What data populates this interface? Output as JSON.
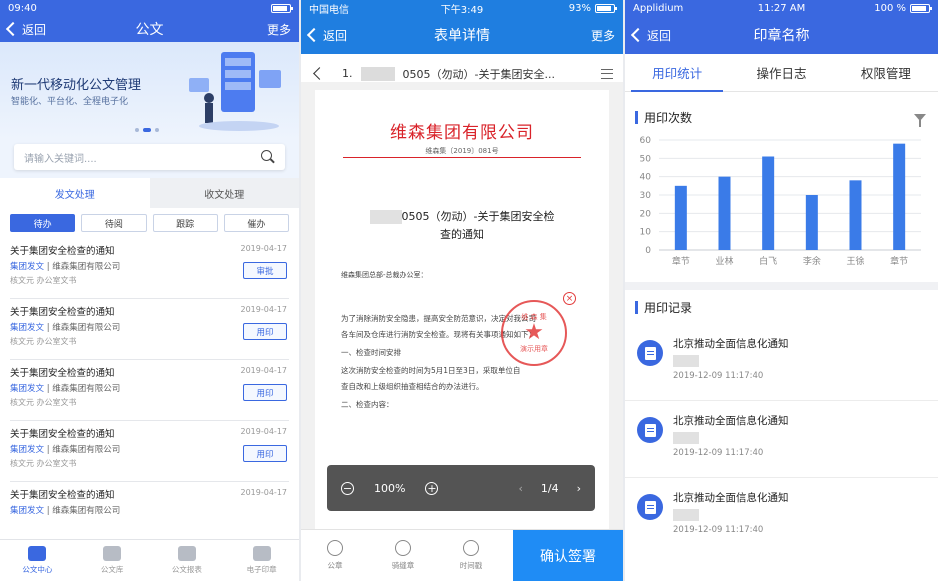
{
  "screen1": {
    "status": {
      "time": "09:40",
      "right": ""
    },
    "nav": {
      "back": "返回",
      "title": "公文",
      "more": "更多"
    },
    "banner": {
      "title": "新一代移动化公文管理",
      "subtitle": "智能化、平台化、全程电子化"
    },
    "search": {
      "placeholder": "请输入关键词...."
    },
    "segments": [
      "发文处理",
      "收文处理"
    ],
    "subtabs": [
      "待办",
      "待阅",
      "跟踪",
      "催办"
    ],
    "items": [
      {
        "title": "关于集团安全检查的通知",
        "date": "2019-04-17",
        "src_a": "集团发文",
        "src_b": "维森集团有限公司",
        "meta": "核文元  办公室文书",
        "btn": "审批"
      },
      {
        "title": "关于集团安全检查的通知",
        "date": "2019-04-17",
        "src_a": "集团发文",
        "src_b": "维森集团有限公司",
        "meta": "核文元  办公室文书",
        "btn": "用印"
      },
      {
        "title": "关于集团安全检查的通知",
        "date": "2019-04-17",
        "src_a": "集团发文",
        "src_b": "维森集团有限公司",
        "meta": "核文元  办公室文书",
        "btn": "用印"
      },
      {
        "title": "关于集团安全检查的通知",
        "date": "2019-04-17",
        "src_a": "集团发文",
        "src_b": "维森集团有限公司",
        "meta": "核文元  办公室文书",
        "btn": "用印"
      },
      {
        "title": "关于集团安全检查的通知",
        "date": "2019-04-17",
        "src_a": "集团发文",
        "src_b": "维森集团有限公司",
        "meta": "",
        "btn": ""
      }
    ],
    "tabbar": [
      "公文中心",
      "公文库",
      "公文报表",
      "电子印章"
    ]
  },
  "screen2": {
    "status": {
      "carrier": "中国电信",
      "time": "下午3:49",
      "battery": "93%"
    },
    "nav": {
      "back": "返回",
      "title": "表单详情",
      "more": "更多"
    },
    "docbar": {
      "prefix": "1.",
      "title": "0505（勿动）-关于集团安全..."
    },
    "doc": {
      "company": "维森集团有限公司",
      "code": "维森集〔2019〕081号",
      "heading1": "0505（勿动）-关于集团安全检",
      "heading2": "查的通知",
      "to": "维森集团总部-总裁办公室：",
      "p1": "为了消除消防安全隐患，提高安全防范意识，决定对我公司",
      "p2": "各车间及仓库进行消防安全检查。现将有关事项通知如下：",
      "p3": "一、检查时间安排",
      "p4": "这次消防安全检查的时间为5月1日至3日，采取单位自",
      "p5": "查自改和上级组织抽查相结合的办法进行。",
      "p6": "二、检查内容：",
      "stamp_top": "维 森 集",
      "stamp_star": "★",
      "stamp_bottom": "演示用章",
      "stamp_close": "×"
    },
    "zoom": {
      "minus": "−",
      "percent": "100%",
      "plus": "+",
      "prev": "‹",
      "page": "1/4",
      "next": "›"
    },
    "tools": [
      "公章",
      "骑缝章",
      "时间戳"
    ],
    "confirm": "确认签署"
  },
  "screen3": {
    "status": {
      "carrier": "Applidium",
      "time": "11:27 AM",
      "battery": "100 %"
    },
    "nav": {
      "back": "返回",
      "title": "印章名称"
    },
    "tabs": [
      "用印统计",
      "操作日志",
      "权限管理"
    ],
    "section_chart": "用印次数",
    "section_records": "用印记录",
    "records": [
      {
        "title": "北京推动全面信息化通知",
        "time": "2019-12-09 11:17:40"
      },
      {
        "title": "北京推动全面信息化通知",
        "time": "2019-12-09 11:17:40"
      },
      {
        "title": "北京推动全面信息化通知",
        "time": "2019-12-09 11:17:40"
      }
    ]
  },
  "chart_data": {
    "type": "bar",
    "categories": [
      "章节",
      "业林",
      "白飞",
      "李余",
      "王徐",
      "章节"
    ],
    "values": [
      35,
      40,
      51,
      30,
      38,
      58
    ],
    "yticks": [
      0,
      10,
      20,
      30,
      40,
      50,
      60
    ],
    "ylim": [
      0,
      60
    ],
    "grid": true,
    "bar_color": "#3a7be8"
  }
}
